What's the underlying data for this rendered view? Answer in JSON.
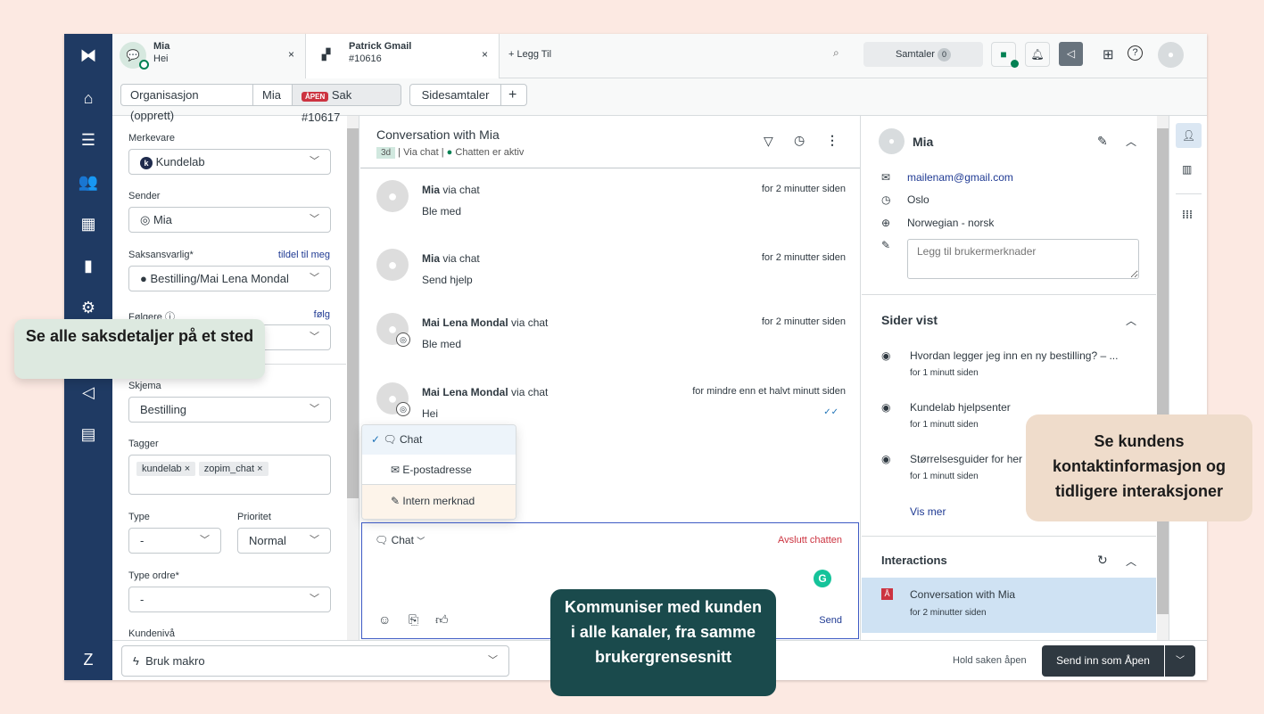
{
  "tabs": [
    {
      "title": "Mia",
      "subtitle": "Hei"
    },
    {
      "title": "Patrick Gmail",
      "subtitle": "#10616"
    }
  ],
  "add_tab": "+ Legg Til",
  "header": {
    "conversations_label": "Samtaler",
    "conversations_count": "0"
  },
  "subnav": {
    "org": "Organisasjon (opprett)",
    "user": "Mia",
    "status_badge": "ÅPEN",
    "ticket": "Sak #10617",
    "side": "Sidesamtaler",
    "plus": "+"
  },
  "left": {
    "brand_label": "Merkevare",
    "brand_value": "Kundelab",
    "sender_label": "Sender",
    "sender_value": "Mia",
    "assignee_label": "Saksansvarlig*",
    "assign_me": "tildel til meg",
    "assignee_value": "Bestilling/Mai Lena Mondal",
    "followers_label": "Følgere",
    "follow": "følg",
    "form_label": "Skjema",
    "form_value": "Bestilling",
    "tags_label": "Tagger",
    "tags": [
      "kundelab",
      "zopim_chat"
    ],
    "type_label": "Type",
    "type_value": "-",
    "priority_label": "Prioritet",
    "priority_value": "Normal",
    "order_label": "Type ordre*",
    "order_value": "-",
    "level_label": "Kundenivå"
  },
  "conversation": {
    "title": "Conversation with Mia",
    "age": "3d",
    "via": "Via chat",
    "status": "Chatten er aktiv",
    "messages": [
      {
        "name": "Mia",
        "via": "via chat",
        "time": "for 2 minutter siden",
        "text": "Ble med"
      },
      {
        "name": "Mia",
        "via": "via chat",
        "time": "for 2 minutter siden",
        "text": "Send hjelp"
      },
      {
        "name": "Mai Lena Mondal",
        "via": "via chat",
        "time": "for 2 minutter siden",
        "text": "Ble med"
      },
      {
        "name": "Mai Lena Mondal",
        "via": "via chat",
        "time": "for mindre enn et halvt minutt siden",
        "text": "Hei"
      }
    ]
  },
  "channel_menu": [
    "Chat",
    "E-postadresse",
    "Intern merknad"
  ],
  "composer": {
    "channel": "Chat",
    "end_chat": "Avslutt chatten",
    "send": "Send"
  },
  "customer": {
    "name": "Mia",
    "email": "mailenam@gmail.com",
    "city": "Oslo",
    "language": "Norwegian - norsk",
    "notes_placeholder": "Legg til brukermerknader"
  },
  "pages": {
    "title": "Sider vist",
    "items": [
      {
        "title": "Hvordan legger jeg inn en ny bestilling? – ...",
        "time": "for 1 minutt siden"
      },
      {
        "title": "Kundelab hjelpsenter",
        "time": "for 1 minutt siden"
      },
      {
        "title": "Størrelsesguider for her",
        "time": "for 1 minutt siden"
      }
    ],
    "more": "Vis mer"
  },
  "interactions": {
    "title": "Interactions",
    "items": [
      {
        "title": "Conversation with Mia",
        "time": "for 2 minutter siden"
      }
    ]
  },
  "footer": {
    "macro": "Bruk makro",
    "hold": "Hold saken åpen",
    "submit": "Send inn som Åpen"
  },
  "callouts": {
    "left": "Se alle saksdetaljer på et sted",
    "center": "Kommuniser med kunden i alle kanaler, fra samme brukergrensesnitt",
    "right": "Se kundens kontaktinformasjon og tidligere interaksjoner"
  },
  "colors": {
    "nav": "#1f3a63",
    "open_badge": "#cc3340",
    "link": "#1f73b7",
    "accent_green": "#038153"
  }
}
